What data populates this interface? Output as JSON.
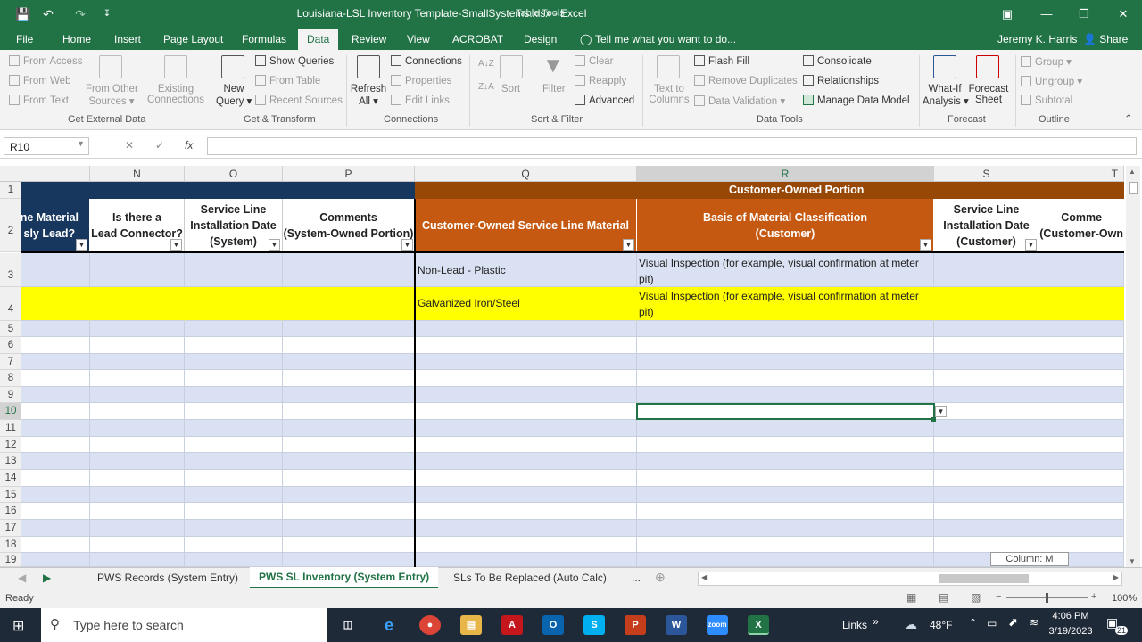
{
  "window": {
    "title": "Louisiana-LSL Inventory Template-SmallSystems.xlsx - Excel",
    "context_tab": "Table Tools",
    "user": "Jeremy K. Harris",
    "share": "Share"
  },
  "menu": {
    "tabs": [
      "File",
      "Home",
      "Insert",
      "Page Layout",
      "Formulas",
      "Data",
      "Review",
      "View",
      "ACROBAT",
      "Design"
    ],
    "active": "Data",
    "tell_me": "Tell me what you want to do..."
  },
  "ribbon": {
    "get_external": {
      "from_access": "From Access",
      "from_web": "From Web",
      "from_text": "From Text",
      "from_other": "From Other",
      "sources": "Sources",
      "existing": "Existing",
      "connections": "Connections",
      "label": "Get External Data"
    },
    "transform": {
      "new": "New",
      "query": "Query",
      "show_queries": "Show Queries",
      "from_table": "From Table",
      "recent_sources": "Recent Sources",
      "label": "Get & Transform"
    },
    "conn": {
      "refresh": "Refresh",
      "all": "All",
      "connections": "Connections",
      "properties": "Properties",
      "edit_links": "Edit Links",
      "label": "Connections"
    },
    "sort": {
      "sort": "Sort",
      "filter": "Filter",
      "clear": "Clear",
      "reapply": "Reapply",
      "advanced": "Advanced",
      "label": "Sort & Filter"
    },
    "tools": {
      "text_to": "Text to",
      "columns": "Columns",
      "flash_fill": "Flash Fill",
      "remove_dup": "Remove Duplicates",
      "data_validation": "Data Validation",
      "consolidate": "Consolidate",
      "relationships": "Relationships",
      "manage_model": "Manage Data Model",
      "label": "Data Tools"
    },
    "forecast": {
      "what_if": "What-If",
      "analysis": "Analysis",
      "forecast": "Forecast",
      "sheet": "Sheet",
      "label": "Forecast"
    },
    "outline": {
      "group": "Group",
      "ungroup": "Ungroup",
      "subtotal": "Subtotal",
      "label": "Outline"
    }
  },
  "formula_bar": {
    "name_box": "R10",
    "fx": "fx",
    "value": ""
  },
  "columns": [
    "N",
    "O",
    "P",
    "Q",
    "R",
    "S",
    "T"
  ],
  "selected_column": "R",
  "row_numbers": [
    "1",
    "2",
    "3",
    "4",
    "5",
    "6",
    "7",
    "8",
    "9",
    "10",
    "11",
    "12",
    "13",
    "14",
    "15",
    "16",
    "17",
    "18",
    "19"
  ],
  "sheet": {
    "group_header": "Customer-Owned Portion",
    "headers": {
      "m": "ne Material\nsly Lead?",
      "n": "Is there a\nLead Connector?",
      "o": "Service Line\nInstallation Date\n(System)",
      "p": "Comments\n(System-Owned Portion)",
      "q": "Customer-Owned Service Line Material",
      "r": "Basis of Material Classification\n(Customer)",
      "s": "Service Line\nInstallation Date\n(Customer)",
      "t": "Comme\n(Customer-Own"
    },
    "row3": {
      "q": "Non-Lead - Plastic",
      "r": "Visual Inspection (for example, visual confirmation at meter pit)"
    },
    "row4": {
      "q": "Galvanized Iron/Steel",
      "r": "Visual Inspection (for example, visual confirmation at meter pit)"
    }
  },
  "tooltip": "Column: M",
  "sheet_tabs": [
    "PWS Records (System Entry)",
    "PWS SL Inventory (System Entry)",
    "SLs To Be Replaced (Auto Calc)"
  ],
  "active_sheet": "PWS SL Inventory (System Entry)",
  "more_tabs": "...",
  "status": {
    "ready": "Ready",
    "zoom": "100%"
  },
  "taskbar": {
    "search": "Type here to search",
    "links": "Links",
    "temp": "48°F",
    "time": "4:06 PM",
    "date": "3/19/2023",
    "notif": "21"
  },
  "colors": {
    "excel_green": "#217346",
    "navy_header": "#17375e",
    "orange_group": "#974706",
    "orange_header": "#c65911",
    "band": "#d9e1f2",
    "yellow": "#ffff00"
  }
}
